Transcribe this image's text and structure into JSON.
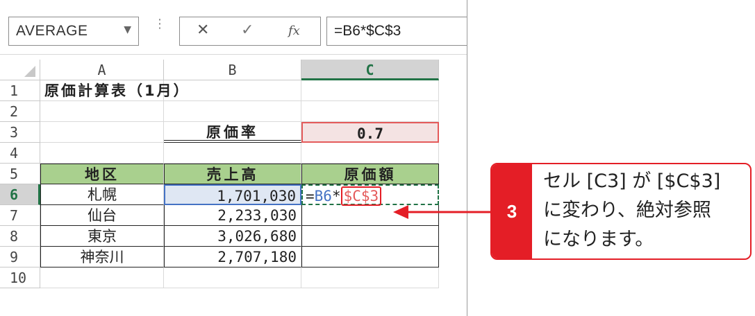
{
  "formula_bar": {
    "name_box": "AVERAGE",
    "name_box_arrow": "▼",
    "dots": "⋮",
    "cancel": "✕",
    "enter": "✓",
    "fx": "fx",
    "formula": "=B6*$C$3"
  },
  "columns": [
    "A",
    "B",
    "C"
  ],
  "rows": [
    "1",
    "2",
    "3",
    "4",
    "5",
    "6",
    "7",
    "8",
    "9",
    "10"
  ],
  "cells": {
    "A1": "原価計算表（1月）",
    "B3": "原価率",
    "C3": "0.7",
    "A5": "地区",
    "B5": "売上高",
    "C5": "原価額",
    "A6": "札幌",
    "B6": "1,701,030",
    "C6_part1": "=",
    "C6_part2": "B6",
    "C6_part3": "*",
    "C6_part4": "$C$3",
    "A7": "仙台",
    "B7": "2,233,030",
    "A8": "東京",
    "B8": "3,026,680",
    "A9": "神奈川",
    "B9": "2,707,180"
  },
  "callout": {
    "number": "3",
    "line1": "セル [C3] が [$C$3]",
    "line2": "に変わり、絶対参照",
    "line3": "になります。"
  },
  "colors": {
    "accent_red": "#e41e26",
    "excel_green": "#217346",
    "header_green": "#a9d08e",
    "ref_blue": "#4472c4",
    "ref_red": "#e45a5a"
  }
}
